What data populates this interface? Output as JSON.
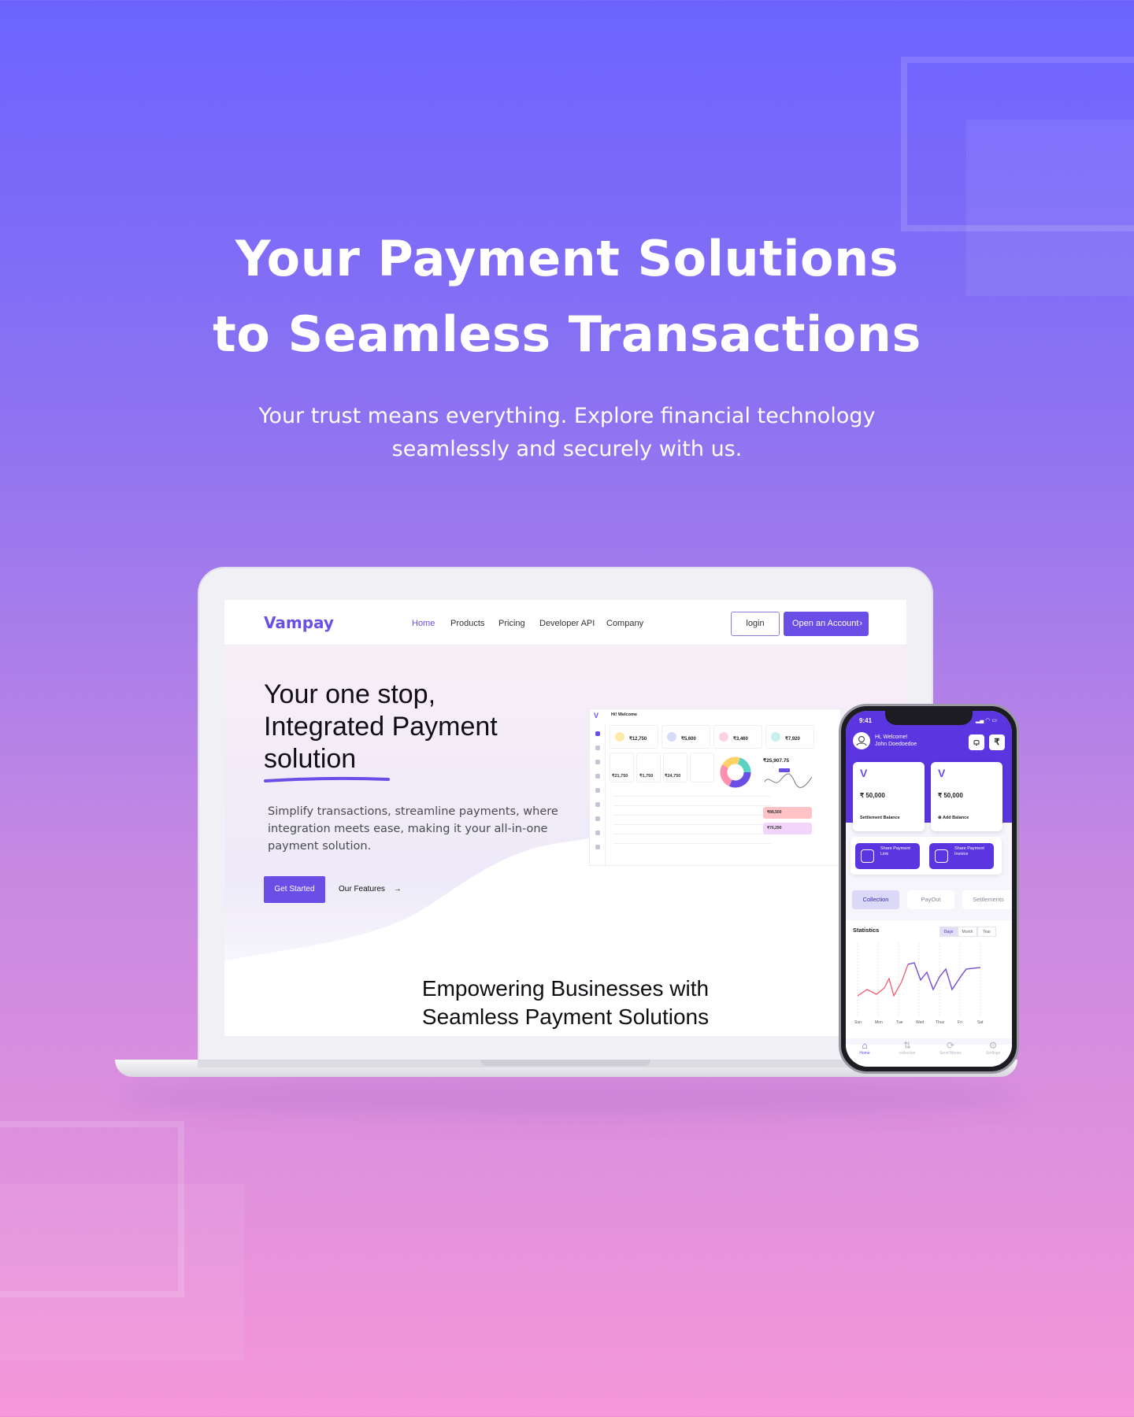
{
  "hero": {
    "title_line1": "Your Payment Solutions",
    "title_line2": "to Seamless Transactions",
    "subtitle_line1": "Your trust means everything. Explore financial technology",
    "subtitle_line2": "seamlessly and securely with us."
  },
  "colors": {
    "brand": "#6a4fe6",
    "background_top": "#6c63ff",
    "background_bottom": "#f597d9"
  },
  "site": {
    "logo": "Vampay",
    "nav": [
      "Home",
      "Products",
      "Pricing",
      "Developer API",
      "Company"
    ],
    "login": "login",
    "open_account": "Open an Account",
    "open_account_icon": "chevron-right-icon",
    "headline_line1": "Your one stop,",
    "headline_line2": "Integrated Payment",
    "headline_line3": "solution",
    "description_line1": "Simplify transactions, streamline payments, where",
    "description_line2": "integration meets ease, making it your all-in-one",
    "description_line3": "payment solution.",
    "get_started": "Get Started",
    "our_features": "Our Features",
    "section_title_line1": "Empowering Businesses with",
    "section_title_line2": "Seamless Payment Solutions"
  },
  "dashboard": {
    "greeting": "Hi! Welcome",
    "logo": "V",
    "cards": [
      "₹12,750",
      "₹5,600",
      "₹3,460",
      "₹7,920"
    ],
    "small_values": [
      "₹21,750",
      "₹1,750",
      "₹24,750"
    ],
    "balance": "₹25,907.75",
    "accounts": [
      "₹88,500",
      "₹76,290"
    ]
  },
  "phone": {
    "time": "9:41",
    "greeting": "Hi, Welcome!",
    "user_name": "John Doedoedoe",
    "bell_icon": "bell-icon",
    "rupee_icon": "₹",
    "settlement_amount": "₹ 50,000",
    "settlement_label": "Settlement Balance",
    "add_amount": "₹ 50,000",
    "add_label": "Add Balance",
    "share_link": "Share Payment Link",
    "share_invoice": "Share Payment Invoice",
    "tabs": [
      "Collection",
      "PayOut",
      "Settlements"
    ],
    "statistics": "Statistics",
    "ranges": [
      "Days",
      "Month",
      "Year"
    ],
    "days": [
      "Sun",
      "Mon",
      "Tue",
      "Wed",
      "Thus",
      "Fri",
      "Sat"
    ],
    "bottom_nav": [
      "Home",
      "collection",
      "Send Money",
      "Settings"
    ]
  }
}
